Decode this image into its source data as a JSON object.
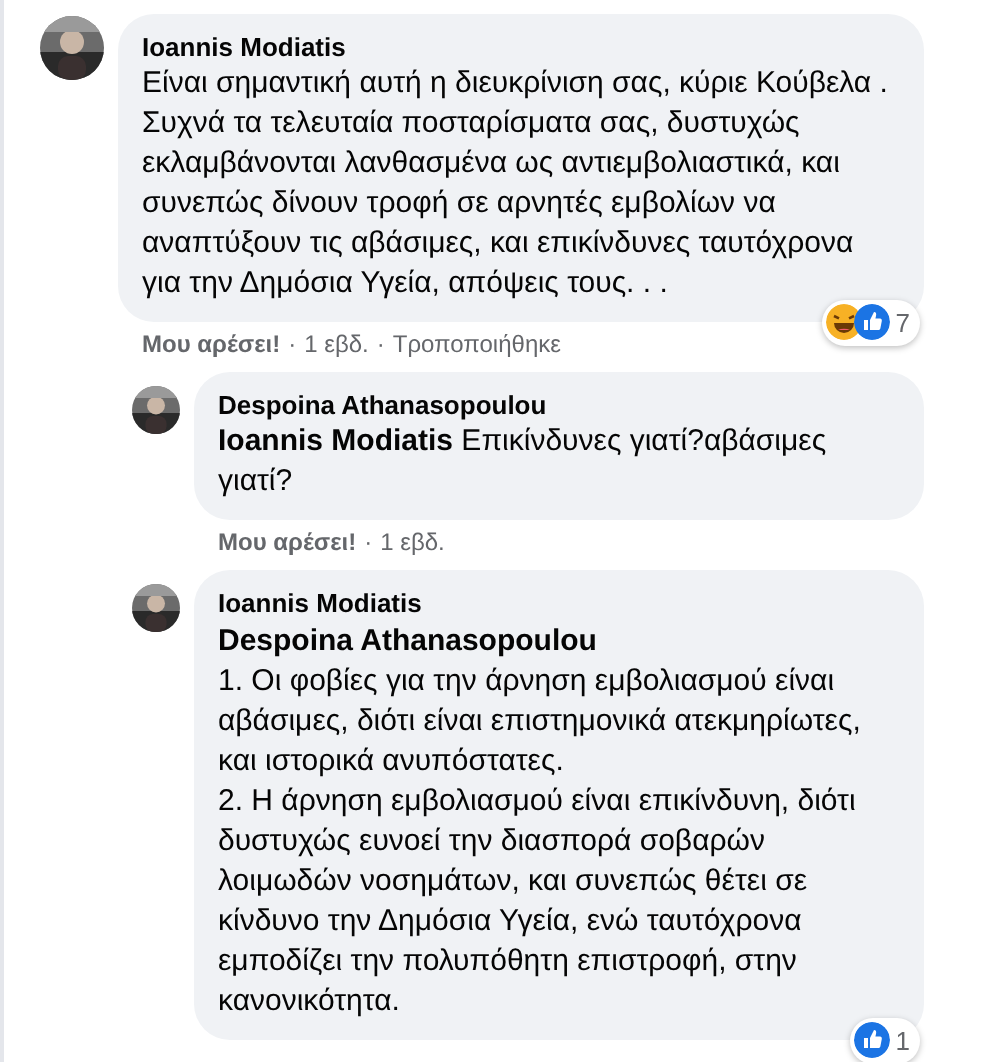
{
  "comments": [
    {
      "author": "Ioannis Modiatis",
      "avatar": {
        "kind": "picture"
      },
      "text": "Είναι σημαντική αυτή η διευκρίνιση σας, κύριε Κούβελα .\nΣυχνά τα τελευταία ποσταρίσματα σας, δυστυχώς εκλαμβάνονται λανθασμένα ως αντιεμβολιαστικά, και συνεπώς δίνουν τροφή σε αρνητές εμβολίων να αναπτύξουν τις αβάσιμες, και επικίνδυνες ταυτόχρονα για την Δημόσια Υγεία, απόψεις τους. . .",
      "reactions": {
        "icons": [
          {
            "kind": "haha"
          },
          {
            "kind": "like"
          }
        ],
        "count": "7"
      },
      "footer": [
        {
          "kind": "link",
          "text": "Μου αρέσει!"
        },
        {
          "kind": "sep",
          "text": "·"
        },
        {
          "kind": "text",
          "text": "1 εβδ."
        },
        {
          "kind": "sep",
          "text": "·"
        },
        {
          "kind": "text",
          "text": "Τροποποιήθηκε"
        }
      ],
      "replies": [
        {
          "author": "Despoina Athanasopoulou",
          "avatar": {
            "kind": "picture"
          },
          "text": "**Ioannis Modiatis** Επικίνδυνες γιατί?αβάσιμες γιατί?",
          "footer": [
            {
              "kind": "link",
              "text": "Μου αρέσει!"
            },
            {
              "kind": "sep",
              "text": "·"
            },
            {
              "kind": "text",
              "text": "1 εβδ."
            }
          ]
        },
        {
          "author": "Ioannis Modiatis",
          "avatar": {
            "kind": "picture"
          },
          "mention": "Despoina Athanasopoulou",
          "text": "1. Οι φοβίες για την άρνηση εμβολιασμού είναι αβάσιμες, διότι είναι επιστημονικά ατεκμηρίωτες, και ιστορικά ανυπόστατες.\n2. Η άρνηση εμβολιασμού είναι επικίνδυνη, διότι δυστυχώς ευνοεί την διασπορά σοβαρών λοιμωδών νοσημάτων, και συνεπώς θέτει σε κίνδυνο την Δημόσια Υγεία, ενώ ταυτόχρονα εμποδίζει την πολυπόθητη επιστροφή, στην κανονικότητα.",
          "reactions": {
            "icons": [
              {
                "kind": "like"
              }
            ],
            "count": "1"
          }
        }
      ]
    }
  ]
}
